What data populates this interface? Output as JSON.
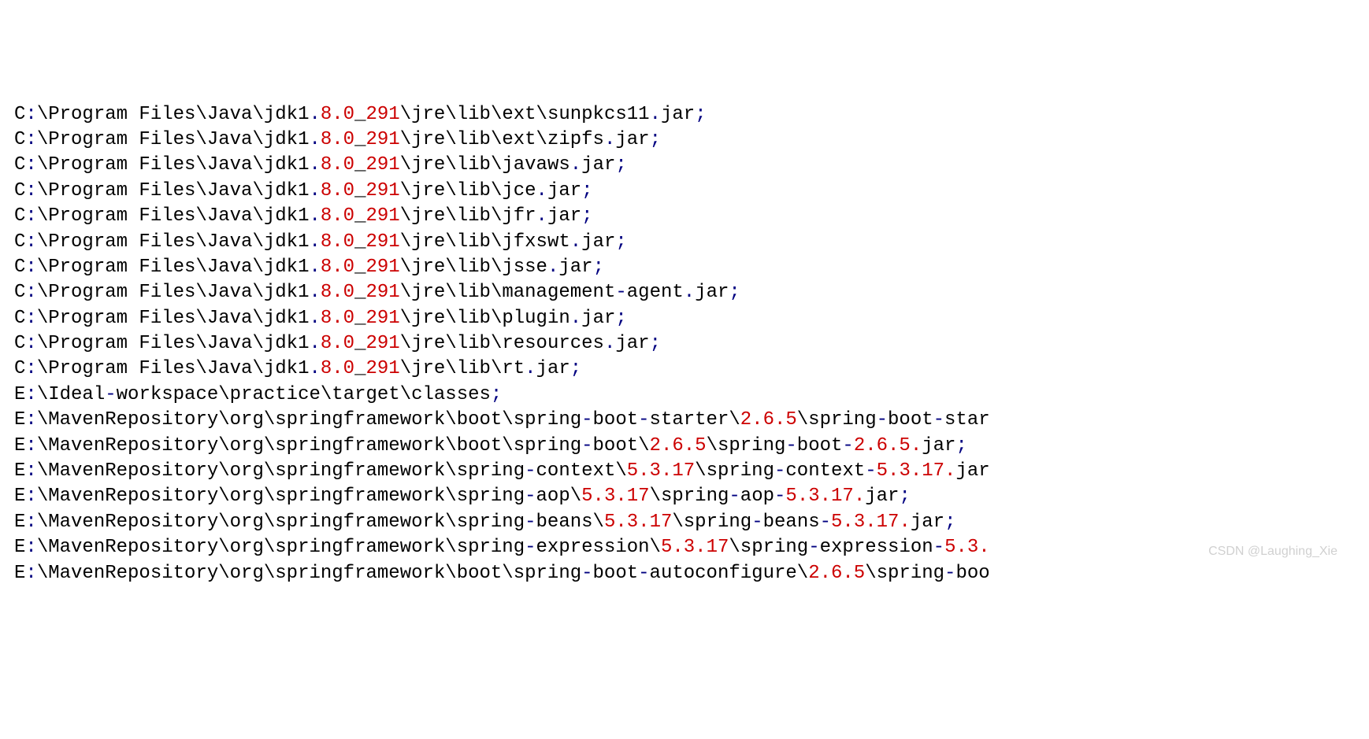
{
  "watermark": "CSDN @Laughing_Xie",
  "lines": [
    [
      {
        "t": "C",
        "c": "black"
      },
      {
        "t": ":",
        "c": "navy"
      },
      {
        "t": "\\Program Files\\Java\\jdk1",
        "c": "black"
      },
      {
        "t": ".",
        "c": "navy"
      },
      {
        "t": "8.0",
        "c": "red"
      },
      {
        "t": "_",
        "c": "black"
      },
      {
        "t": "291",
        "c": "red"
      },
      {
        "t": "\\jre\\lib\\ext\\sunpkcs11",
        "c": "black"
      },
      {
        "t": ".",
        "c": "navy"
      },
      {
        "t": "jar",
        "c": "black"
      },
      {
        "t": ";",
        "c": "navy"
      }
    ],
    [
      {
        "t": "C",
        "c": "black"
      },
      {
        "t": ":",
        "c": "navy"
      },
      {
        "t": "\\Program Files\\Java\\jdk1",
        "c": "black"
      },
      {
        "t": ".",
        "c": "navy"
      },
      {
        "t": "8.0",
        "c": "red"
      },
      {
        "t": "_",
        "c": "black"
      },
      {
        "t": "291",
        "c": "red"
      },
      {
        "t": "\\jre\\lib\\ext\\zipfs",
        "c": "black"
      },
      {
        "t": ".",
        "c": "navy"
      },
      {
        "t": "jar",
        "c": "black"
      },
      {
        "t": ";",
        "c": "navy"
      }
    ],
    [
      {
        "t": "C",
        "c": "black"
      },
      {
        "t": ":",
        "c": "navy"
      },
      {
        "t": "\\Program Files\\Java\\jdk1",
        "c": "black"
      },
      {
        "t": ".",
        "c": "navy"
      },
      {
        "t": "8.0",
        "c": "red"
      },
      {
        "t": "_",
        "c": "black"
      },
      {
        "t": "291",
        "c": "red"
      },
      {
        "t": "\\jre\\lib\\javaws",
        "c": "black"
      },
      {
        "t": ".",
        "c": "navy"
      },
      {
        "t": "jar",
        "c": "black"
      },
      {
        "t": ";",
        "c": "navy"
      }
    ],
    [
      {
        "t": "C",
        "c": "black"
      },
      {
        "t": ":",
        "c": "navy"
      },
      {
        "t": "\\Program Files\\Java\\jdk1",
        "c": "black"
      },
      {
        "t": ".",
        "c": "navy"
      },
      {
        "t": "8.0",
        "c": "red"
      },
      {
        "t": "_",
        "c": "black"
      },
      {
        "t": "291",
        "c": "red"
      },
      {
        "t": "\\jre\\lib\\jce",
        "c": "black"
      },
      {
        "t": ".",
        "c": "navy"
      },
      {
        "t": "jar",
        "c": "black"
      },
      {
        "t": ";",
        "c": "navy"
      }
    ],
    [
      {
        "t": "C",
        "c": "black"
      },
      {
        "t": ":",
        "c": "navy"
      },
      {
        "t": "\\Program Files\\Java\\jdk1",
        "c": "black"
      },
      {
        "t": ".",
        "c": "navy"
      },
      {
        "t": "8.0",
        "c": "red"
      },
      {
        "t": "_",
        "c": "black"
      },
      {
        "t": "291",
        "c": "red"
      },
      {
        "t": "\\jre\\lib\\jfr",
        "c": "black"
      },
      {
        "t": ".",
        "c": "navy"
      },
      {
        "t": "jar",
        "c": "black"
      },
      {
        "t": ";",
        "c": "navy"
      }
    ],
    [
      {
        "t": "C",
        "c": "black"
      },
      {
        "t": ":",
        "c": "navy"
      },
      {
        "t": "\\Program Files\\Java\\jdk1",
        "c": "black"
      },
      {
        "t": ".",
        "c": "navy"
      },
      {
        "t": "8.0",
        "c": "red"
      },
      {
        "t": "_",
        "c": "black"
      },
      {
        "t": "291",
        "c": "red"
      },
      {
        "t": "\\jre\\lib\\jfxswt",
        "c": "black"
      },
      {
        "t": ".",
        "c": "navy"
      },
      {
        "t": "jar",
        "c": "black"
      },
      {
        "t": ";",
        "c": "navy"
      }
    ],
    [
      {
        "t": "C",
        "c": "black"
      },
      {
        "t": ":",
        "c": "navy"
      },
      {
        "t": "\\Program Files\\Java\\jdk1",
        "c": "black"
      },
      {
        "t": ".",
        "c": "navy"
      },
      {
        "t": "8.0",
        "c": "red"
      },
      {
        "t": "_",
        "c": "black"
      },
      {
        "t": "291",
        "c": "red"
      },
      {
        "t": "\\jre\\lib\\jsse",
        "c": "black"
      },
      {
        "t": ".",
        "c": "navy"
      },
      {
        "t": "jar",
        "c": "black"
      },
      {
        "t": ";",
        "c": "navy"
      }
    ],
    [
      {
        "t": "C",
        "c": "black"
      },
      {
        "t": ":",
        "c": "navy"
      },
      {
        "t": "\\Program Files\\Java\\jdk1",
        "c": "black"
      },
      {
        "t": ".",
        "c": "navy"
      },
      {
        "t": "8.0",
        "c": "red"
      },
      {
        "t": "_",
        "c": "black"
      },
      {
        "t": "291",
        "c": "red"
      },
      {
        "t": "\\jre\\lib\\management",
        "c": "black"
      },
      {
        "t": "-",
        "c": "navy"
      },
      {
        "t": "agent",
        "c": "black"
      },
      {
        "t": ".",
        "c": "navy"
      },
      {
        "t": "jar",
        "c": "black"
      },
      {
        "t": ";",
        "c": "navy"
      }
    ],
    [
      {
        "t": "C",
        "c": "black"
      },
      {
        "t": ":",
        "c": "navy"
      },
      {
        "t": "\\Program Files\\Java\\jdk1",
        "c": "black"
      },
      {
        "t": ".",
        "c": "navy"
      },
      {
        "t": "8.0",
        "c": "red"
      },
      {
        "t": "_",
        "c": "black"
      },
      {
        "t": "291",
        "c": "red"
      },
      {
        "t": "\\jre\\lib\\plugin",
        "c": "black"
      },
      {
        "t": ".",
        "c": "navy"
      },
      {
        "t": "jar",
        "c": "black"
      },
      {
        "t": ";",
        "c": "navy"
      }
    ],
    [
      {
        "t": "C",
        "c": "black"
      },
      {
        "t": ":",
        "c": "navy"
      },
      {
        "t": "\\Program Files\\Java\\jdk1",
        "c": "black"
      },
      {
        "t": ".",
        "c": "navy"
      },
      {
        "t": "8.0",
        "c": "red"
      },
      {
        "t": "_",
        "c": "black"
      },
      {
        "t": "291",
        "c": "red"
      },
      {
        "t": "\\jre\\lib\\resources",
        "c": "black"
      },
      {
        "t": ".",
        "c": "navy"
      },
      {
        "t": "jar",
        "c": "black"
      },
      {
        "t": ";",
        "c": "navy"
      }
    ],
    [
      {
        "t": "C",
        "c": "black"
      },
      {
        "t": ":",
        "c": "navy"
      },
      {
        "t": "\\Program Files\\Java\\jdk1",
        "c": "black"
      },
      {
        "t": ".",
        "c": "navy"
      },
      {
        "t": "8.0",
        "c": "red"
      },
      {
        "t": "_",
        "c": "black"
      },
      {
        "t": "291",
        "c": "red"
      },
      {
        "t": "\\jre\\lib\\rt",
        "c": "black"
      },
      {
        "t": ".",
        "c": "navy"
      },
      {
        "t": "jar",
        "c": "black"
      },
      {
        "t": ";",
        "c": "navy"
      }
    ],
    [
      {
        "t": "E",
        "c": "black"
      },
      {
        "t": ":",
        "c": "navy"
      },
      {
        "t": "\\Ideal",
        "c": "black"
      },
      {
        "t": "-",
        "c": "navy"
      },
      {
        "t": "workspace\\practice\\target\\classes",
        "c": "black"
      },
      {
        "t": ";",
        "c": "navy"
      }
    ],
    [
      {
        "t": "E",
        "c": "black"
      },
      {
        "t": ":",
        "c": "navy"
      },
      {
        "t": "\\MavenRepository\\org\\springframework\\boot\\spring",
        "c": "black"
      },
      {
        "t": "-",
        "c": "navy"
      },
      {
        "t": "boot",
        "c": "black"
      },
      {
        "t": "-",
        "c": "navy"
      },
      {
        "t": "starter\\",
        "c": "black"
      },
      {
        "t": "2.6.5",
        "c": "red"
      },
      {
        "t": "\\spring",
        "c": "black"
      },
      {
        "t": "-",
        "c": "navy"
      },
      {
        "t": "boot",
        "c": "black"
      },
      {
        "t": "-",
        "c": "navy"
      },
      {
        "t": "star",
        "c": "black"
      }
    ],
    [
      {
        "t": "E",
        "c": "black"
      },
      {
        "t": ":",
        "c": "navy"
      },
      {
        "t": "\\MavenRepository\\org\\springframework\\boot\\spring",
        "c": "black"
      },
      {
        "t": "-",
        "c": "navy"
      },
      {
        "t": "boot\\",
        "c": "black"
      },
      {
        "t": "2.6.5",
        "c": "red"
      },
      {
        "t": "\\spring",
        "c": "black"
      },
      {
        "t": "-",
        "c": "navy"
      },
      {
        "t": "boot",
        "c": "black"
      },
      {
        "t": "-",
        "c": "navy"
      },
      {
        "t": "2.6.5.",
        "c": "red"
      },
      {
        "t": "jar",
        "c": "black"
      },
      {
        "t": ";",
        "c": "navy"
      }
    ],
    [
      {
        "t": "E",
        "c": "black"
      },
      {
        "t": ":",
        "c": "navy"
      },
      {
        "t": "\\MavenRepository\\org\\springframework\\spring",
        "c": "black"
      },
      {
        "t": "-",
        "c": "navy"
      },
      {
        "t": "context\\",
        "c": "black"
      },
      {
        "t": "5.3.17",
        "c": "red"
      },
      {
        "t": "\\spring",
        "c": "black"
      },
      {
        "t": "-",
        "c": "navy"
      },
      {
        "t": "context",
        "c": "black"
      },
      {
        "t": "-",
        "c": "navy"
      },
      {
        "t": "5.3.17.",
        "c": "red"
      },
      {
        "t": "jar",
        "c": "black"
      }
    ],
    [
      {
        "t": "E",
        "c": "black"
      },
      {
        "t": ":",
        "c": "navy"
      },
      {
        "t": "\\MavenRepository\\org\\springframework\\spring",
        "c": "black"
      },
      {
        "t": "-",
        "c": "navy"
      },
      {
        "t": "aop\\",
        "c": "black"
      },
      {
        "t": "5.3.17",
        "c": "red"
      },
      {
        "t": "\\spring",
        "c": "black"
      },
      {
        "t": "-",
        "c": "navy"
      },
      {
        "t": "aop",
        "c": "black"
      },
      {
        "t": "-",
        "c": "navy"
      },
      {
        "t": "5.3.17.",
        "c": "red"
      },
      {
        "t": "jar",
        "c": "black"
      },
      {
        "t": ";",
        "c": "navy"
      }
    ],
    [
      {
        "t": "E",
        "c": "black"
      },
      {
        "t": ":",
        "c": "navy"
      },
      {
        "t": "\\MavenRepository\\org\\springframework\\spring",
        "c": "black"
      },
      {
        "t": "-",
        "c": "navy"
      },
      {
        "t": "beans\\",
        "c": "black"
      },
      {
        "t": "5.3.17",
        "c": "red"
      },
      {
        "t": "\\spring",
        "c": "black"
      },
      {
        "t": "-",
        "c": "navy"
      },
      {
        "t": "beans",
        "c": "black"
      },
      {
        "t": "-",
        "c": "navy"
      },
      {
        "t": "5.3.17.",
        "c": "red"
      },
      {
        "t": "jar",
        "c": "black"
      },
      {
        "t": ";",
        "c": "navy"
      }
    ],
    [
      {
        "t": "E",
        "c": "black"
      },
      {
        "t": ":",
        "c": "navy"
      },
      {
        "t": "\\MavenRepository\\org\\springframework\\spring",
        "c": "black"
      },
      {
        "t": "-",
        "c": "navy"
      },
      {
        "t": "expression\\",
        "c": "black"
      },
      {
        "t": "5.3.17",
        "c": "red"
      },
      {
        "t": "\\spring",
        "c": "black"
      },
      {
        "t": "-",
        "c": "navy"
      },
      {
        "t": "expression",
        "c": "black"
      },
      {
        "t": "-",
        "c": "navy"
      },
      {
        "t": "5.3.",
        "c": "red"
      }
    ],
    [
      {
        "t": "E",
        "c": "black"
      },
      {
        "t": ":",
        "c": "navy"
      },
      {
        "t": "\\MavenRepository\\org\\springframework\\boot\\spring",
        "c": "black"
      },
      {
        "t": "-",
        "c": "navy"
      },
      {
        "t": "boot",
        "c": "black"
      },
      {
        "t": "-",
        "c": "navy"
      },
      {
        "t": "autoconfigure\\",
        "c": "black"
      },
      {
        "t": "2.6.5",
        "c": "red"
      },
      {
        "t": "\\spring",
        "c": "black"
      },
      {
        "t": "-",
        "c": "navy"
      },
      {
        "t": "boo",
        "c": "black"
      }
    ]
  ]
}
